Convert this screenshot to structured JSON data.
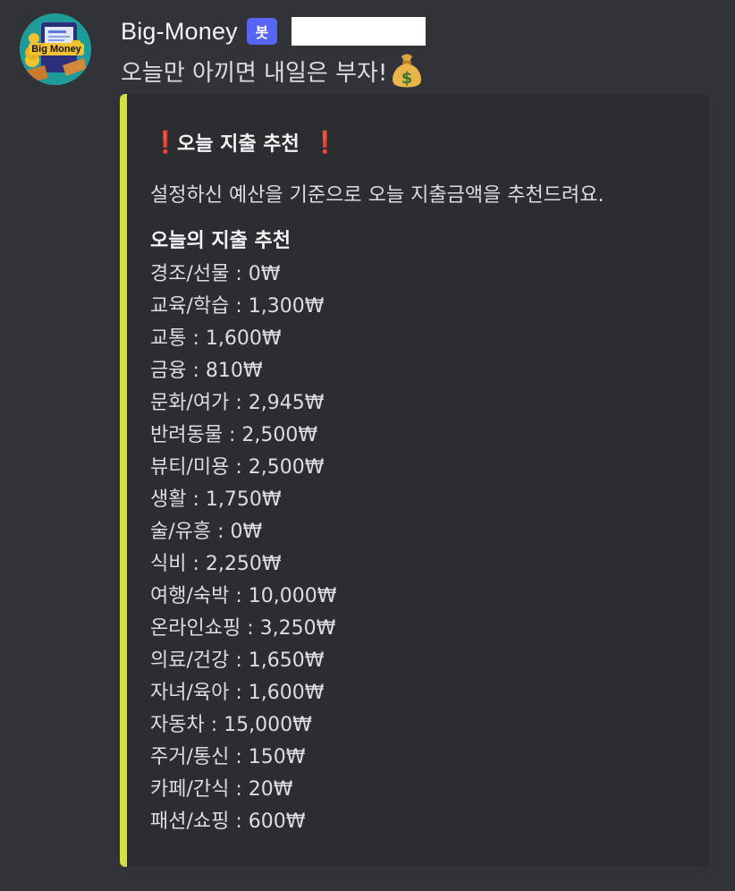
{
  "user": {
    "name": "Big-Money",
    "bot_tag": "봇",
    "avatar_text": "Big Money"
  },
  "message": {
    "text": "오늘만 아끼면 내일은 부자!",
    "emoji_icon": "moneybag-icon"
  },
  "embed": {
    "accent_color": "#d6e03a",
    "title_icon": "❗",
    "title": "오늘 지출 추천",
    "description": "설정하신 예산을 기준으로 오늘 지출금액을 추천드려요.",
    "list_title": "오늘의 지출 추천",
    "items": [
      "경조/선물 : 0₩",
      "교육/학습 : 1,300₩",
      "교통 : 1,600₩",
      "금융 : 810₩",
      "문화/여가 : 2,945₩",
      "반려동물 : 2,500₩",
      "뷰티/미용 : 2,500₩",
      "생활 : 1,750₩",
      "술/유흥 : 0₩",
      "식비 : 2,250₩",
      "여행/숙박 : 10,000₩",
      "온라인쇼핑 : 3,250₩",
      "의료/건강 : 1,650₩",
      "자녀/육아 : 1,600₩",
      "자동차 : 15,000₩",
      "주거/통신 : 150₩",
      "카페/간식 : 20₩",
      "패션/쇼핑 : 600₩"
    ]
  }
}
